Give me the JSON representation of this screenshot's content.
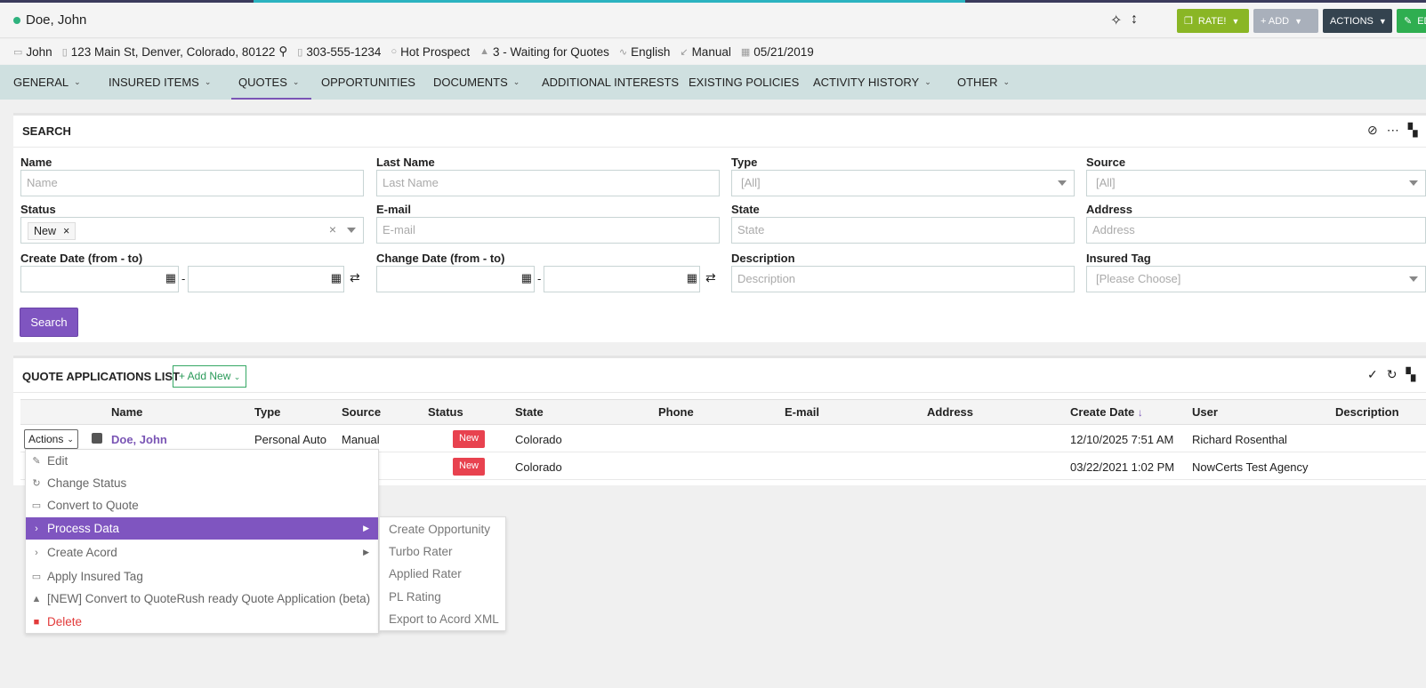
{
  "header": {
    "name": "Doe, John",
    "buttons": {
      "rate": "RATE!",
      "add": "+ ADD",
      "actions": "ACTIONS",
      "edit": "ED"
    },
    "colors": {
      "rate": "#8ab625",
      "add": "#a9b0bb",
      "actions": "#34434f",
      "edit": "#2fae50",
      "status_dot": "#2fb27e"
    }
  },
  "info": {
    "first_name": "John",
    "address": "123 Main St, Denver, Colorado, 80122",
    "phone": "303-555-1234",
    "prospect": "Hot Prospect",
    "stage": "3 - Waiting for Quotes",
    "language": "English",
    "source": "Manual",
    "date": "05/21/2019"
  },
  "nav": {
    "tabs": [
      {
        "label": "GENERAL"
      },
      {
        "label": "INSURED ITEMS"
      },
      {
        "label": "QUOTES"
      },
      {
        "label": "OPPORTUNITIES"
      },
      {
        "label": "DOCUMENTS"
      },
      {
        "label": "ADDITIONAL INTERESTS"
      },
      {
        "label": "EXISTING POLICIES"
      },
      {
        "label": "ACTIVITY HISTORY"
      },
      {
        "label": "OTHER"
      }
    ]
  },
  "search": {
    "title": "SEARCH",
    "labels": {
      "name": "Name",
      "last_name": "Last Name",
      "type": "Type",
      "source": "Source",
      "status": "Status",
      "email": "E-mail",
      "state": "State",
      "address": "Address",
      "create_date": "Create Date (from - to)",
      "change_date": "Change Date (from - to)",
      "description": "Description",
      "insured_tag": "Insured Tag"
    },
    "placeholders": {
      "name": "Name",
      "last_name": "Last Name",
      "email": "E-mail",
      "state": "State",
      "address": "Address",
      "description": "Description"
    },
    "selects": {
      "type": "[All]",
      "source": "[All]",
      "insured_tag": "[Please Choose]"
    },
    "status_tag": "New",
    "date_separator": "-",
    "search_button": "Search",
    "accent_color": "#7f55c0"
  },
  "list": {
    "title": "QUOTE APPLICATIONS LIST",
    "add_new": "+ Add New",
    "columns": [
      "Name",
      "Type",
      "Source",
      "Status",
      "State",
      "Phone",
      "E-mail",
      "Address",
      "Create Date",
      "User",
      "Description"
    ],
    "sort_indicator": "↓",
    "rows": [
      {
        "actions": "Actions",
        "name": "Doe, John",
        "type": "Personal Auto",
        "source": "Manual",
        "status": "New",
        "state": "Colorado",
        "create_date": "12/10/2025 7:51 AM",
        "user": "Richard Rosenthal"
      },
      {
        "status": "New",
        "state": "Colorado",
        "create_date": "03/22/2021 1:02 PM",
        "user": "NowCerts Test Agency"
      }
    ],
    "badge_color": "#e8424f"
  },
  "menu": {
    "items": [
      {
        "label": "Edit",
        "icon": "pencil-icon"
      },
      {
        "label": "Change Status",
        "icon": "refresh-icon"
      },
      {
        "label": "Convert to Quote",
        "icon": "tag-icon"
      },
      {
        "label": "Process Data",
        "icon": "chevron-right-icon"
      },
      {
        "label": "Create Acord",
        "icon": "chevron-right-icon"
      },
      {
        "label": "Apply Insured Tag",
        "icon": "tag-icon"
      },
      {
        "label": "[NEW] Convert to QuoteRush ready Quote Application (beta)",
        "icon": "cubes-icon"
      },
      {
        "label": "Delete",
        "icon": "trash-icon"
      }
    ],
    "submenu": [
      "Create Opportunity",
      "Turbo Rater",
      "Applied Rater",
      "PL Rating",
      "Export to Acord XML"
    ]
  }
}
